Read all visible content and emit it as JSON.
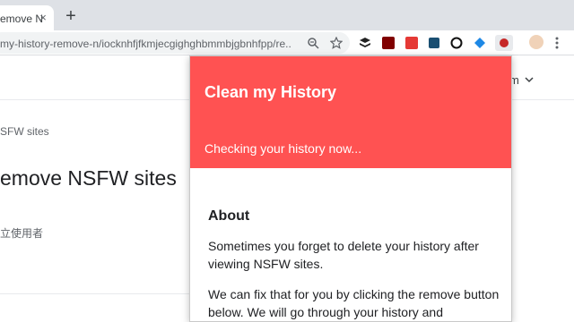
{
  "browser": {
    "tab_title": "emove NSFW",
    "tab_close": "×",
    "new_tab": "+",
    "url": "my-history-remove-n/iocknhfjfkmjecgighghbmmbjgbnhfpp/re..."
  },
  "page": {
    "account_label": "m",
    "breadcrumb": "SFW sites",
    "title": "emove NSFW sites",
    "subtext": "立使用者"
  },
  "popup": {
    "title": "Clean my History",
    "status": "Checking your history now...",
    "about_heading": "About",
    "paragraph1": "Sometimes you forget to delete your history after viewing NSFW sites.",
    "paragraph2": "We can fix that for you by clicking the remove button below. We will go through your history and"
  },
  "colors": {
    "popup_header": "#ff5252",
    "tabstrip": "#dee1e6"
  }
}
